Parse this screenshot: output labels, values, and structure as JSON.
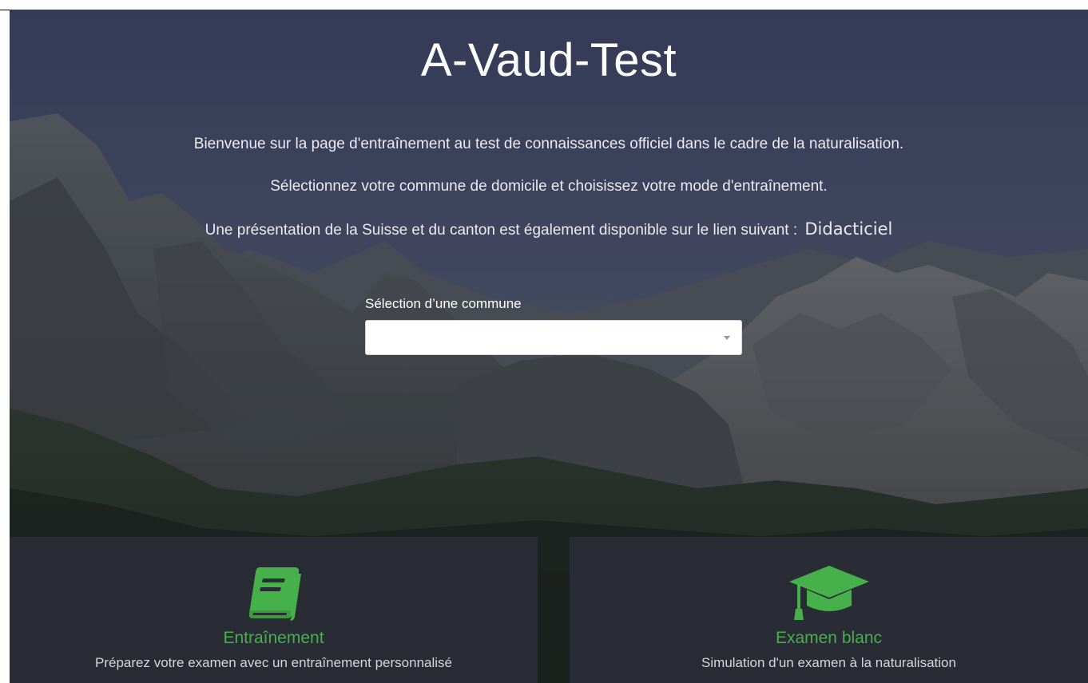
{
  "header": {
    "title": "A-Vaud-Test"
  },
  "intro": {
    "line1": "Bienvenue sur la page d'entraînement au test de connaissances officiel dans le cadre de la naturalisation.",
    "line2": "Sélectionnez votre commune de domicile et choisissez votre mode d'entraînement.",
    "line3": "Une présentation de la Suisse et du canton est également disponible sur le lien suivant :",
    "link_label": "Didacticiel"
  },
  "commune_select": {
    "label": "Sélection d’une commune",
    "selected_value": ""
  },
  "modes": [
    {
      "icon": "book-icon",
      "title": "Entraînement",
      "description": "Préparez votre examen avec un entraînement personnalisé"
    },
    {
      "icon": "graduation-cap-icon",
      "title": "Examen blanc",
      "description": "Simulation d'un examen à la naturalisation"
    }
  ],
  "colors": {
    "accent": "#46b14a",
    "card_background": "#2a2c36",
    "text_light": "#e9ebef"
  }
}
